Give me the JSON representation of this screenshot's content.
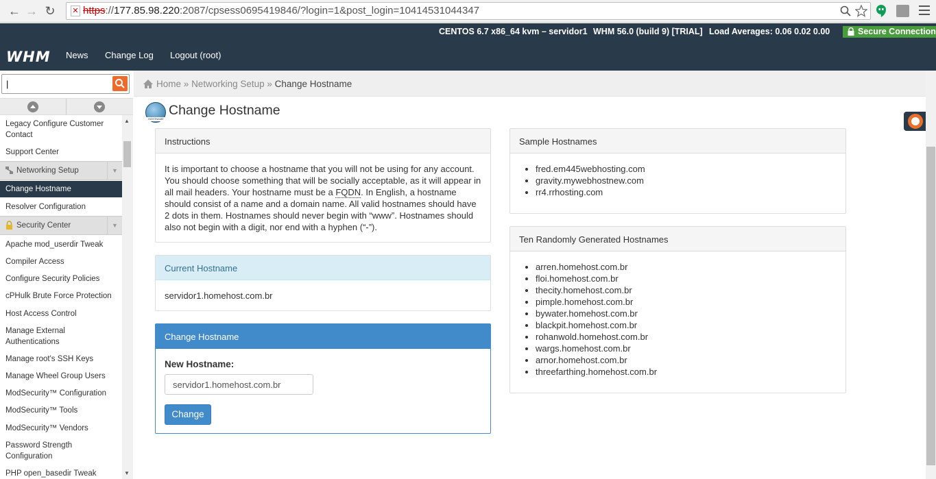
{
  "browser": {
    "url_scheme": "https",
    "url_host": "177.85.98.220",
    "url_rest": ":2087/cpsess0695419846/?login=1&post_login=10414531044347"
  },
  "status_bar": {
    "system": "CENTOS 6.7 x86_64 kvm – servidor1",
    "version": "WHM 56.0 (build 9) [TRIAL]",
    "load": "Load Averages: 0.06 0.02 0.00",
    "secure": "Secure Connection"
  },
  "topnav": {
    "logo": "WHM",
    "news": "News",
    "changelog": "Change Log",
    "logout": "Logout (root)"
  },
  "sidebar": {
    "search_value": "|",
    "items": [
      "Legacy Configure Customer Contact",
      "Support Center",
      "Networking Setup",
      "Change Hostname",
      "Resolver Configuration",
      "Security Center",
      "Apache mod_userdir Tweak",
      "Compiler Access",
      "Configure Security Policies",
      "cPHulk Brute Force Protection",
      "Host Access Control",
      "Manage External Authentications",
      "Manage root's SSH Keys",
      "Manage Wheel Group Users",
      "ModSecurity™ Configuration",
      "ModSecurity™ Tools",
      "ModSecurity™ Vendors",
      "Password Strength Configuration",
      "PHP open_basedir Tweak"
    ]
  },
  "breadcrumb": {
    "home": "Home",
    "sep1": "»",
    "networking": "Networking Setup",
    "sep2": "»",
    "current": "Change Hostname"
  },
  "page": {
    "title": "Change Hostname",
    "icon_label": "HOSTNAME"
  },
  "instructions": {
    "heading": "Instructions",
    "text_1": "It is important to choose a hostname that you will not be using for any account. You should choose something that will be socially acceptable, as it will appear in all mail headers. Your hostname must be a ",
    "fqdn": "FQDN",
    "text_2": ". In English, a hostname should consist of a name and a domain name. All valid hostnames should have 2 dots in them. Hostnames should never begin with “www”. Hostnames should also not begin with a digit, nor end with a hyphen (“-”)."
  },
  "current": {
    "heading": "Current Hostname",
    "value": "servidor1.homehost.com.br"
  },
  "change_form": {
    "heading": "Change Hostname",
    "label": "New Hostname:",
    "input_value": "servidor1.homehost.com.br",
    "button": "Change"
  },
  "samples": {
    "heading": "Sample Hostnames",
    "items": [
      "fred.em445webhosting.com",
      "gravity.mywebhostnew.com",
      "rr4.rrhosting.com"
    ]
  },
  "random": {
    "heading": "Ten Randomly Generated Hostnames",
    "items": [
      "arren.homehost.com.br",
      "floi.homehost.com.br",
      "thecity.homehost.com.br",
      "pimple.homehost.com.br",
      "bywater.homehost.com.br",
      "blackpit.homehost.com.br",
      "rohanwold.homehost.com.br",
      "wargs.homehost.com.br",
      "arnor.homehost.com.br",
      "threefarthing.homehost.com.br"
    ]
  },
  "colors": {
    "nav_bg": "#293a4a",
    "secure_green": "#4a9d3c",
    "primary_blue": "#428bca",
    "search_orange": "#ec6a2a"
  }
}
